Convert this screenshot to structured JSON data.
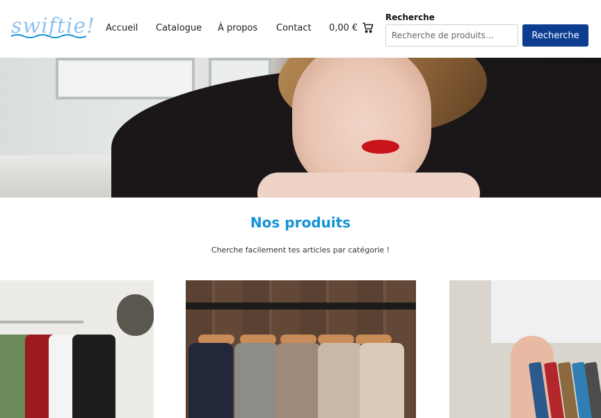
{
  "brand": {
    "logo_text": "swiftie!"
  },
  "nav": {
    "items": [
      {
        "label": "Accueil"
      },
      {
        "label": "Catalogue"
      },
      {
        "label": "À propos"
      },
      {
        "label": "Contact"
      }
    ],
    "cart_total": "0,00 €"
  },
  "search": {
    "label": "Recherche",
    "placeholder": "Recherche de produits…",
    "button_label": "Recherche"
  },
  "section": {
    "title": "Nos produits",
    "subtitle": "Cherche facilement tes articles par catégorie !"
  },
  "colors": {
    "accent": "#1593d6",
    "button": "#0d3d91",
    "logo": "#8fc3ef"
  }
}
